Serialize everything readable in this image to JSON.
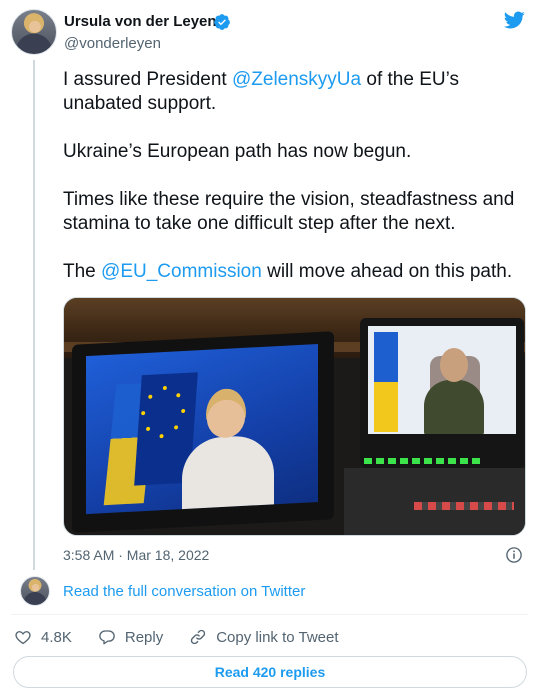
{
  "author": {
    "name": "Ursula von der Leyen",
    "handle": "@vonderleyen"
  },
  "tweet": {
    "p1_before": "I assured President ",
    "p1_mention": "@ZelenskyyUa",
    "p1_after": " of the EU’s unabated support.",
    "p2": "Ukraine’s European path has now begun.",
    "p3": "Times like these require the vision, steadfastness and stamina to take one difficult step after the next.",
    "p4_before": "The ",
    "p4_mention": "@EU_Commission",
    "p4_after": " will move ahead on this path."
  },
  "meta": {
    "timestamp": "3:58 AM · Mar 18, 2022"
  },
  "conversation": {
    "link_label": "Read the full conversation on Twitter"
  },
  "actions": {
    "likes": "4.8K",
    "reply_label": "Reply",
    "copy_label": "Copy link to Tweet"
  },
  "replies_button": "Read 420 replies",
  "colors": {
    "accent": "#1d9bf0",
    "text": "#0f1419",
    "muted": "#536471"
  }
}
